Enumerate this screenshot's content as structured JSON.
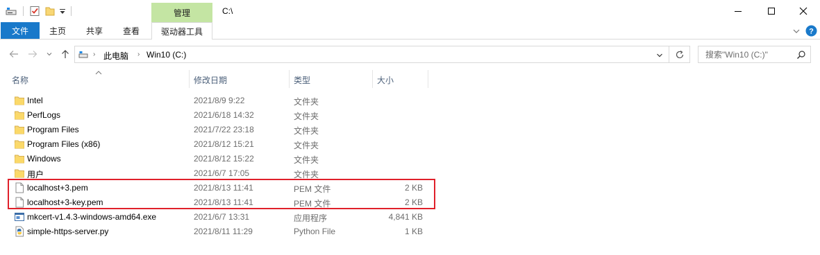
{
  "titlebar": {
    "title": "C:\\",
    "manage_tab": "管理",
    "icons": [
      "drive-icon",
      "properties-check-icon",
      "new-folder-icon",
      "dropdown-icon"
    ],
    "window_buttons": [
      "minimize-icon",
      "maximize-icon",
      "close-icon"
    ]
  },
  "ribbon": {
    "tabs": [
      "文件",
      "主页",
      "共享",
      "查看"
    ],
    "drive_tools_tab": "驱动器工具",
    "expand_icon": "chevron-down-icon",
    "help_icon": "help-icon"
  },
  "address": {
    "nav": [
      "back-arrow-icon",
      "forward-arrow-icon",
      "recent-dropdown-icon",
      "up-arrow-icon"
    ],
    "crumbs": [
      "此电脑",
      "Win10 (C:)"
    ],
    "search_placeholder": "搜索\"Win10 (C:)\""
  },
  "columns": {
    "name": "名称",
    "date": "修改日期",
    "type": "类型",
    "size": "大小"
  },
  "files": [
    {
      "name": "Intel",
      "date": "2021/8/9 9:22",
      "type": "文件夹",
      "size": "",
      "icon": "folder-icon"
    },
    {
      "name": "PerfLogs",
      "date": "2021/6/18 14:32",
      "type": "文件夹",
      "size": "",
      "icon": "folder-icon"
    },
    {
      "name": "Program Files",
      "date": "2021/7/22 23:18",
      "type": "文件夹",
      "size": "",
      "icon": "folder-icon"
    },
    {
      "name": "Program Files (x86)",
      "date": "2021/8/12 15:21",
      "type": "文件夹",
      "size": "",
      "icon": "folder-icon"
    },
    {
      "name": "Windows",
      "date": "2021/8/12 15:22",
      "type": "文件夹",
      "size": "",
      "icon": "folder-icon"
    },
    {
      "name": "用户",
      "date": "2021/6/7 17:05",
      "type": "文件夹",
      "size": "",
      "icon": "folder-icon"
    },
    {
      "name": "localhost+3.pem",
      "date": "2021/8/13 11:41",
      "type": "PEM 文件",
      "size": "2 KB",
      "icon": "file-icon"
    },
    {
      "name": "localhost+3-key.pem",
      "date": "2021/8/13 11:41",
      "type": "PEM 文件",
      "size": "2 KB",
      "icon": "file-icon"
    },
    {
      "name": "mkcert-v1.4.3-windows-amd64.exe",
      "date": "2021/6/7 13:31",
      "type": "应用程序",
      "size": "4,841 KB",
      "icon": "exe-icon"
    },
    {
      "name": "simple-https-server.py",
      "date": "2021/8/11 11:29",
      "type": "Python File",
      "size": "1 KB",
      "icon": "python-file-icon"
    }
  ],
  "colors": {
    "file_tab": "#1979ca",
    "manage_tab": "#c4e5a3",
    "folder": "#f8d775",
    "highlight_border": "#e0202a"
  }
}
